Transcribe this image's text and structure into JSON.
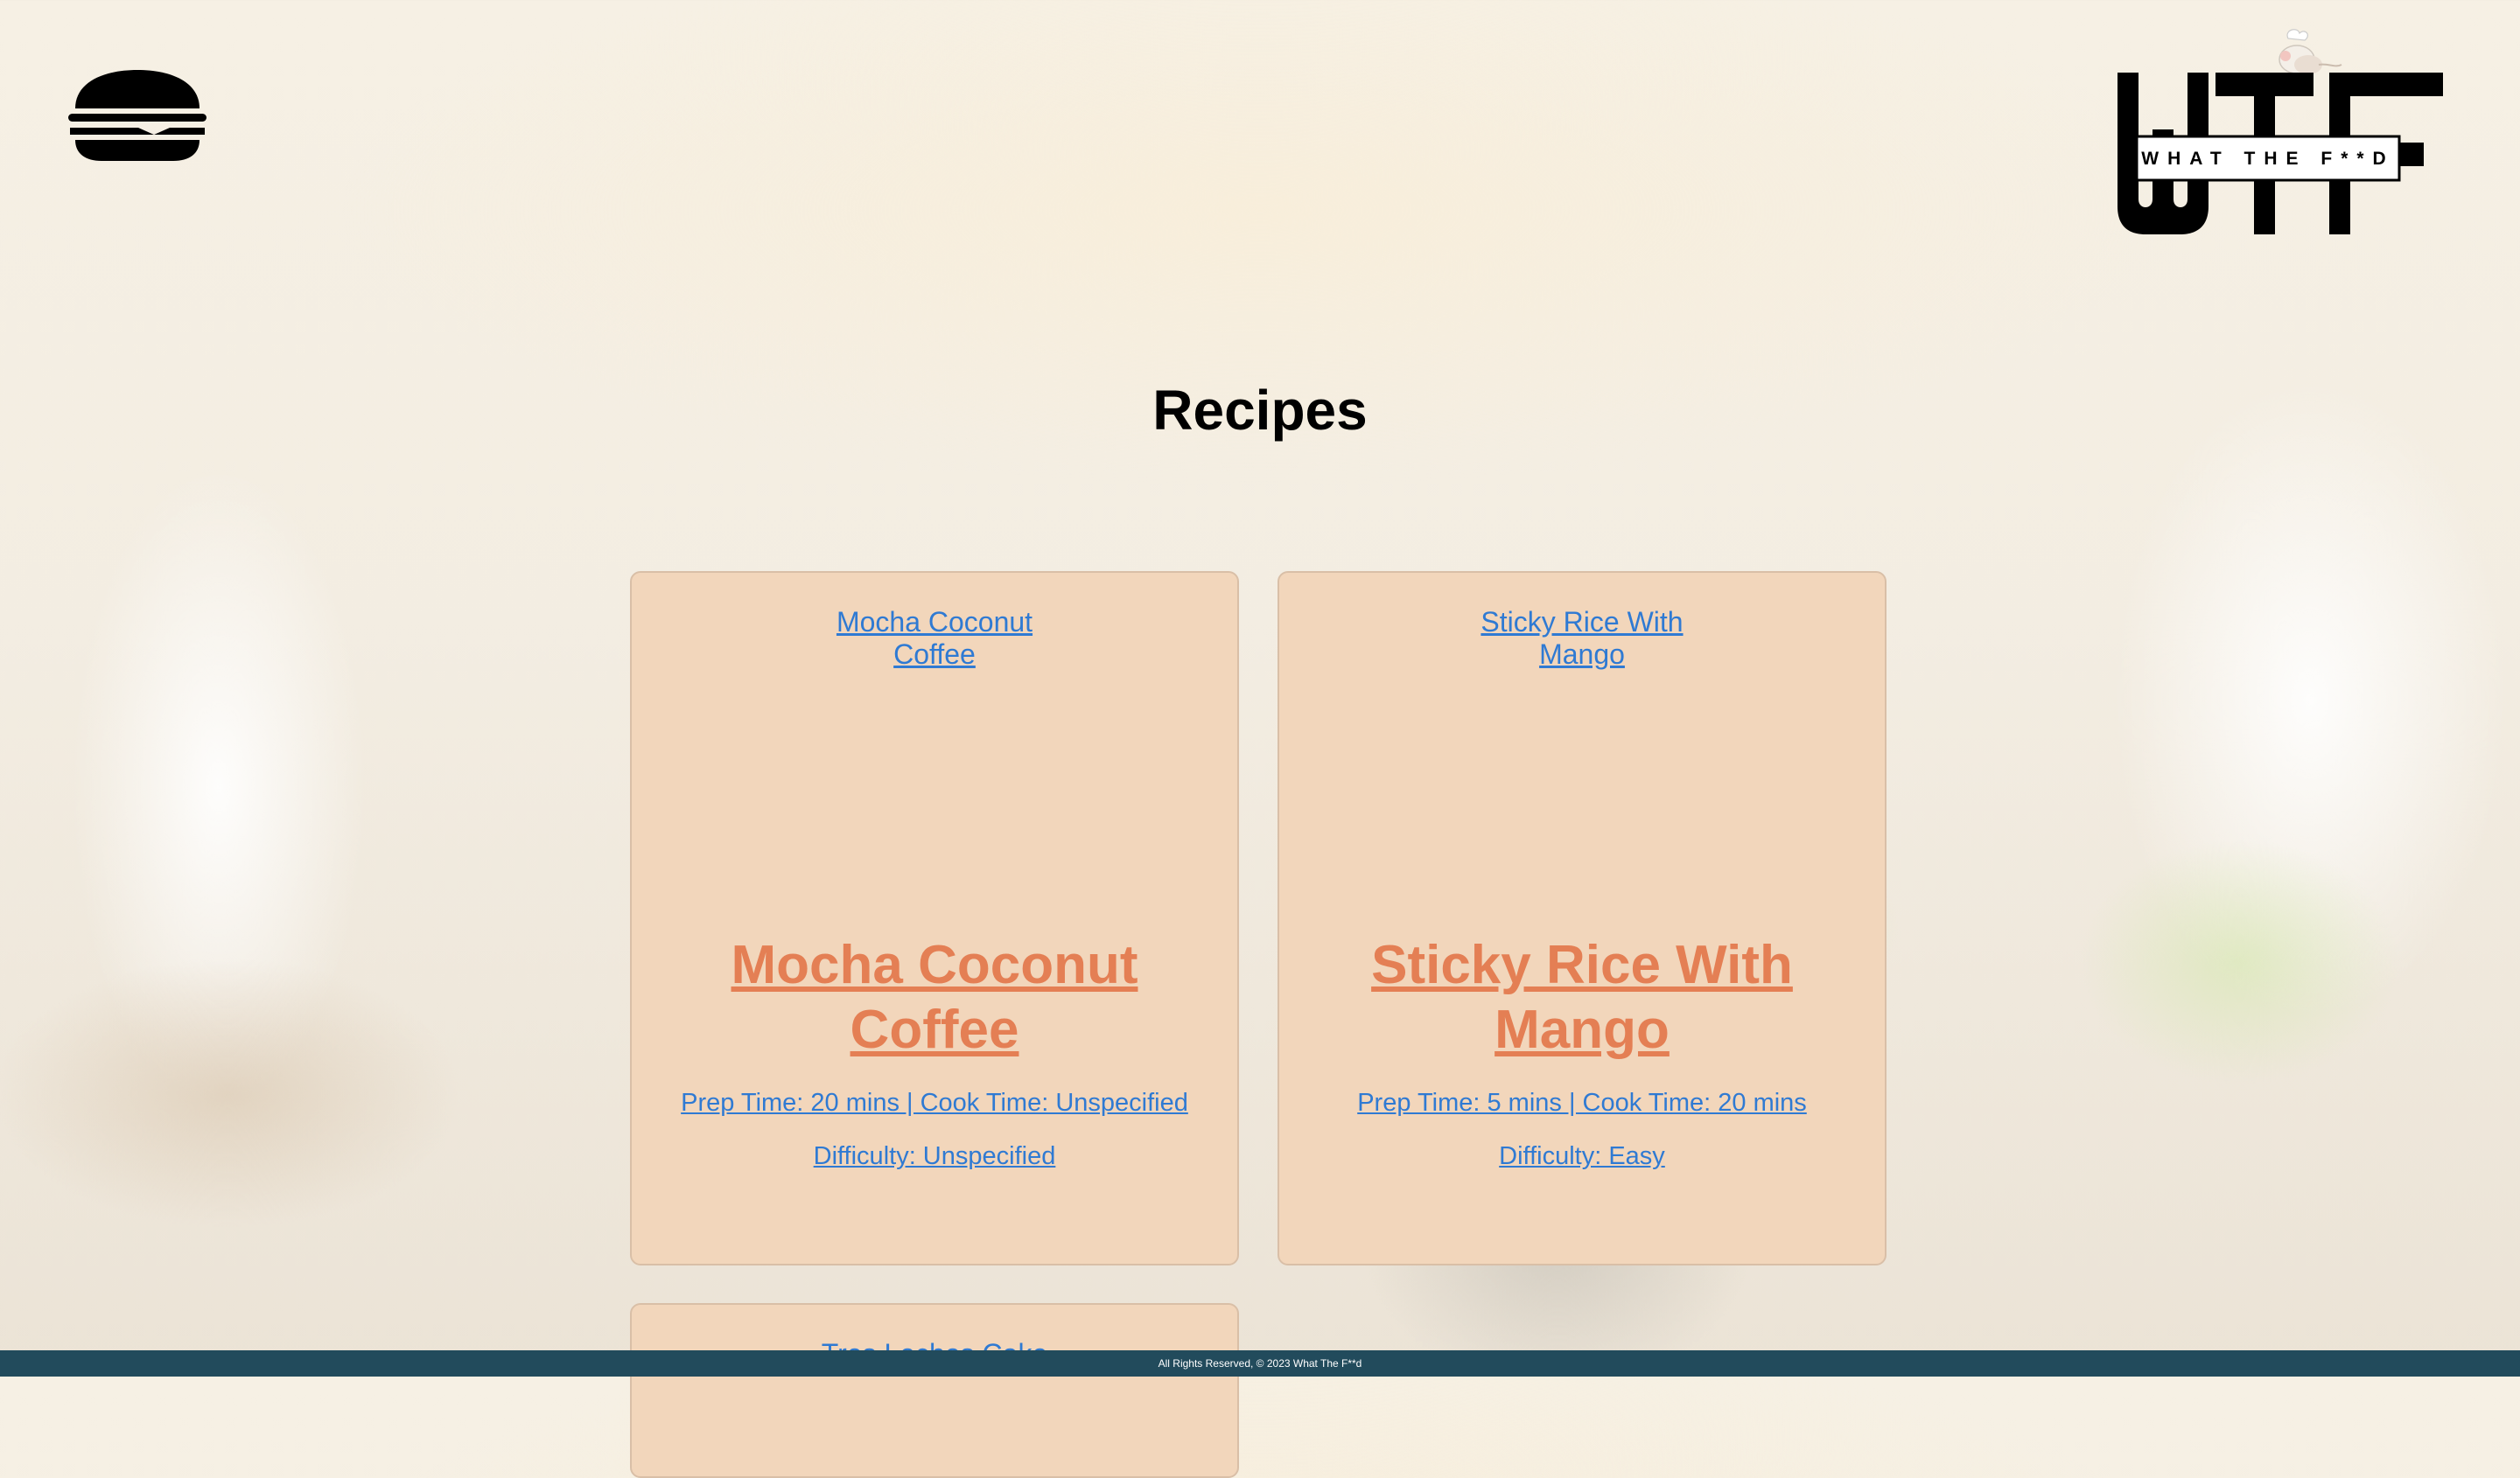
{
  "header": {
    "menu_icon": "hamburger-menu-icon",
    "logo": {
      "big_text": "WTF",
      "tagline": "WHAT THE F**D"
    }
  },
  "main": {
    "title": "Recipes",
    "cards": [
      {
        "small_title": "Mocha Coconut Coffee",
        "title": "Mocha Coconut Coffee",
        "times": "Prep Time: 20 mins | Cook Time: Unspecified",
        "difficulty": "Difficulty: Unspecified"
      },
      {
        "small_title": "Sticky Rice With Mango",
        "title": "Sticky Rice With Mango",
        "times": "Prep Time: 5 mins | Cook Time: 20 mins",
        "difficulty": "Difficulty: Easy"
      },
      {
        "small_title": "Tres Leches Cake"
      }
    ]
  },
  "footer": {
    "text": "All Rights Reserved, © 2023 What The F**d"
  },
  "colors": {
    "card_bg": "#f2d6bb",
    "link_blue": "#2f7ad3",
    "title_orange": "#e47f54",
    "footer_bg": "#224b5c"
  }
}
